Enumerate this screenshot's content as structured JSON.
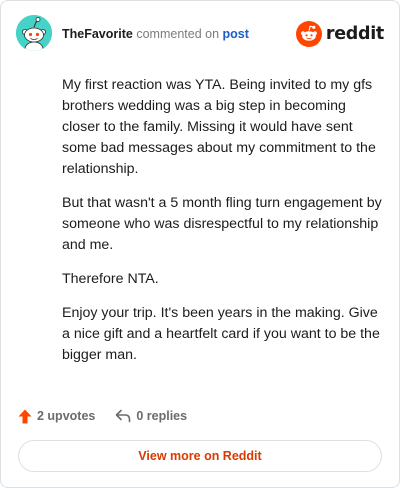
{
  "header": {
    "author": "TheFavorite",
    "action": "commented on",
    "post_link": "post"
  },
  "logo": {
    "text": "reddit",
    "icon": "reddit-snoo-icon",
    "brand_color": "#ff4500"
  },
  "comment": {
    "paragraphs": [
      "My first reaction was YTA. Being invited to my gfs brothers wedding was a big step in becoming closer to the family. Missing it would have sent some bad messages about my commitment to the relationship.",
      "But that wasn't a 5 month fling turn engagement by someone who was disrespectful to my relationship and me.",
      "Therefore NTA.",
      "Enjoy your trip. It's been years in the making. Give a nice gift and a heartfelt card if you want to be the bigger man."
    ]
  },
  "footer": {
    "upvotes": "2 upvotes",
    "replies": "0 replies",
    "upvote_icon": "upvote-arrow-icon",
    "reply_icon": "reply-arrow-icon",
    "upvote_color": "#ff4500"
  },
  "view_more": {
    "label": "View more on Reddit",
    "color": "#d93a00"
  },
  "avatar": {
    "icon": "snoo-avatar-icon",
    "background": "#45d2c7"
  }
}
